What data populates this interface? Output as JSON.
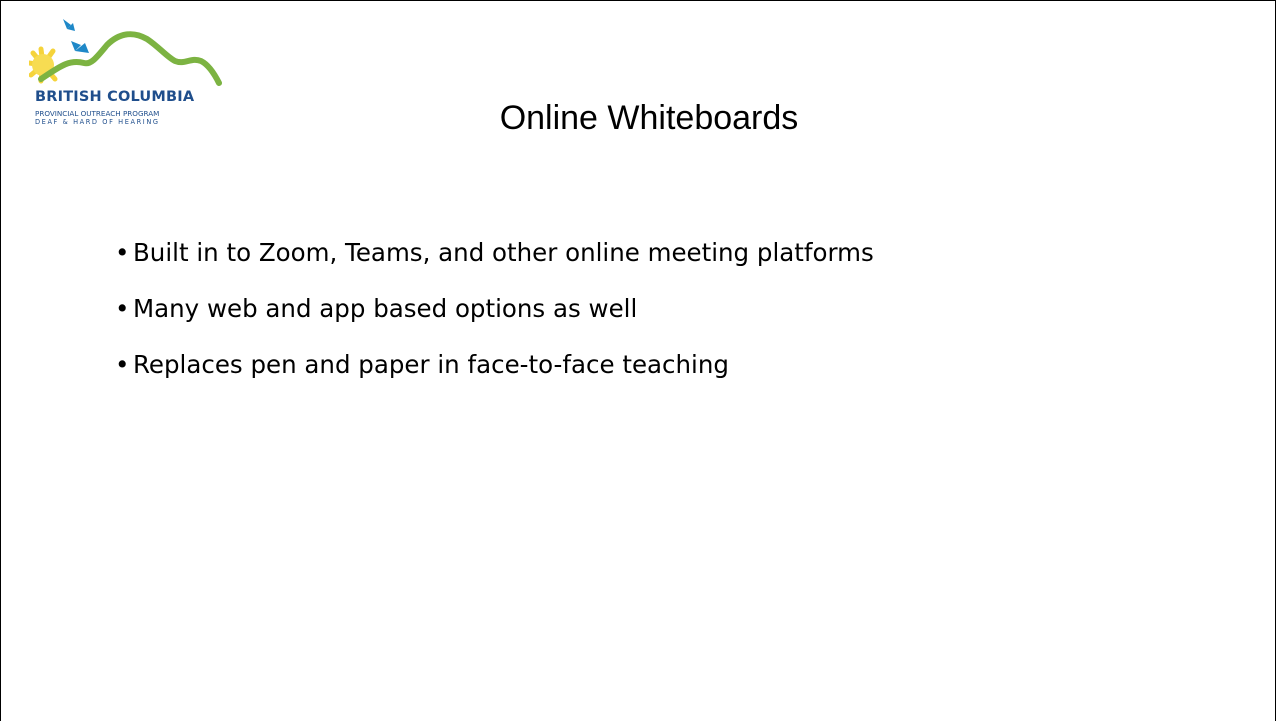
{
  "logo": {
    "line1": "BRITISH COLUMBIA",
    "line2": "PROVINCIAL OUTREACH PROGRAM",
    "line3": "DEAF & HARD OF HEARING",
    "colors": {
      "navy": "#1f4e8c",
      "green": "#7cb342",
      "sun": "#f5d33a",
      "butterfly": "#1e88c8"
    }
  },
  "slide": {
    "title": "Online Whiteboards",
    "bullet_symbol": "•",
    "bullets": [
      "Built in to Zoom, Teams, and other online meeting platforms",
      "Many web and app based options as well",
      "Replaces pen and paper in face-to-face teaching"
    ]
  }
}
